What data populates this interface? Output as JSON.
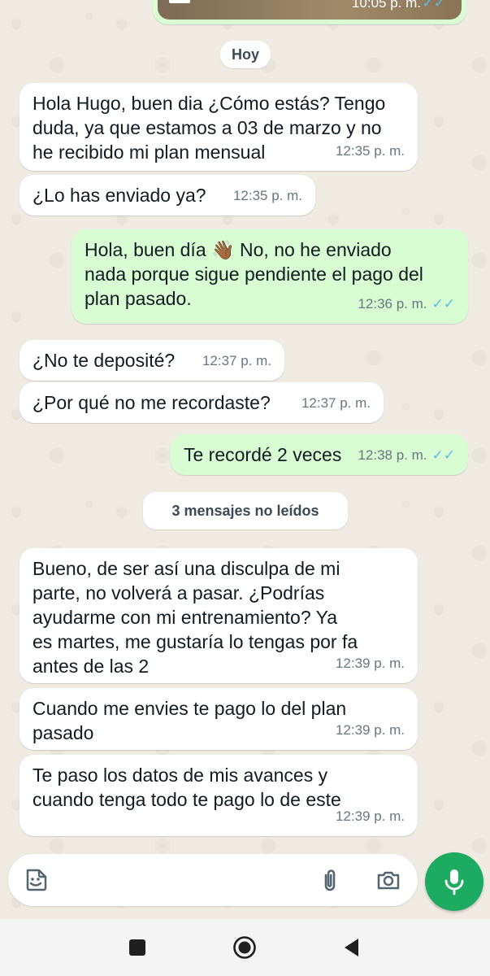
{
  "top_media": {
    "badge": "HD",
    "time": "10:05 p. m.",
    "ticks": "✓✓"
  },
  "date_divider": "Hoy",
  "messages": [
    {
      "dir": "in",
      "text": "Hola Hugo, buen dia ¿Cómo estás? Tengo\nduda, ya que estamos a 03 de marzo y no\nhe recibido mi plan mensual",
      "time": "12:35 p. m."
    },
    {
      "dir": "in",
      "text": "¿Lo has enviado ya?",
      "time": "12:35 p. m."
    },
    {
      "dir": "out",
      "text": "Hola, buen día 👋🏾 No, no he enviado\nnada porque sigue pendiente el pago del\nplan pasado.",
      "time": "12:36 p. m.",
      "ticks": "✓✓"
    },
    {
      "dir": "in",
      "text": "¿No te deposité?",
      "time": "12:37 p. m."
    },
    {
      "dir": "in",
      "text": "¿Por qué no me recordaste?",
      "time": "12:37 p. m."
    },
    {
      "dir": "out",
      "text": "Te recordé 2 veces",
      "time": "12:38 p. m.",
      "ticks": "✓✓"
    },
    {
      "dir": "in",
      "text": "Bueno, de ser así una disculpa de mi\nparte, no volverá a pasar. ¿Podrías\nayudarme con mi entrenamiento? Ya\nes martes, me gustaría lo tengas por fa\nantes de las 2",
      "time": "12:39 p. m."
    },
    {
      "dir": "in",
      "text": "Cuando me envies te pago lo del plan\npasado",
      "time": "12:39 p. m."
    },
    {
      "dir": "in",
      "text": "Te paso los datos de mis avances y\ncuando tenga todo te pago lo de este",
      "time": "12:39 p. m."
    }
  ],
  "unread_divider": "3 mensajes no leídos",
  "input": {
    "placeholder": ""
  },
  "icons": {
    "sticker": "sticker-icon",
    "attach": "paperclip-icon",
    "camera": "camera-icon",
    "mic": "microphone-icon",
    "nav_square": "recents-icon",
    "nav_home": "home-icon",
    "nav_back": "back-icon"
  },
  "colors": {
    "incoming": "#ffffff",
    "outgoing": "#d9fdd3",
    "accent": "#1daa61",
    "read_ticks": "#53bdeb",
    "wallpaper": "#efeae2"
  }
}
